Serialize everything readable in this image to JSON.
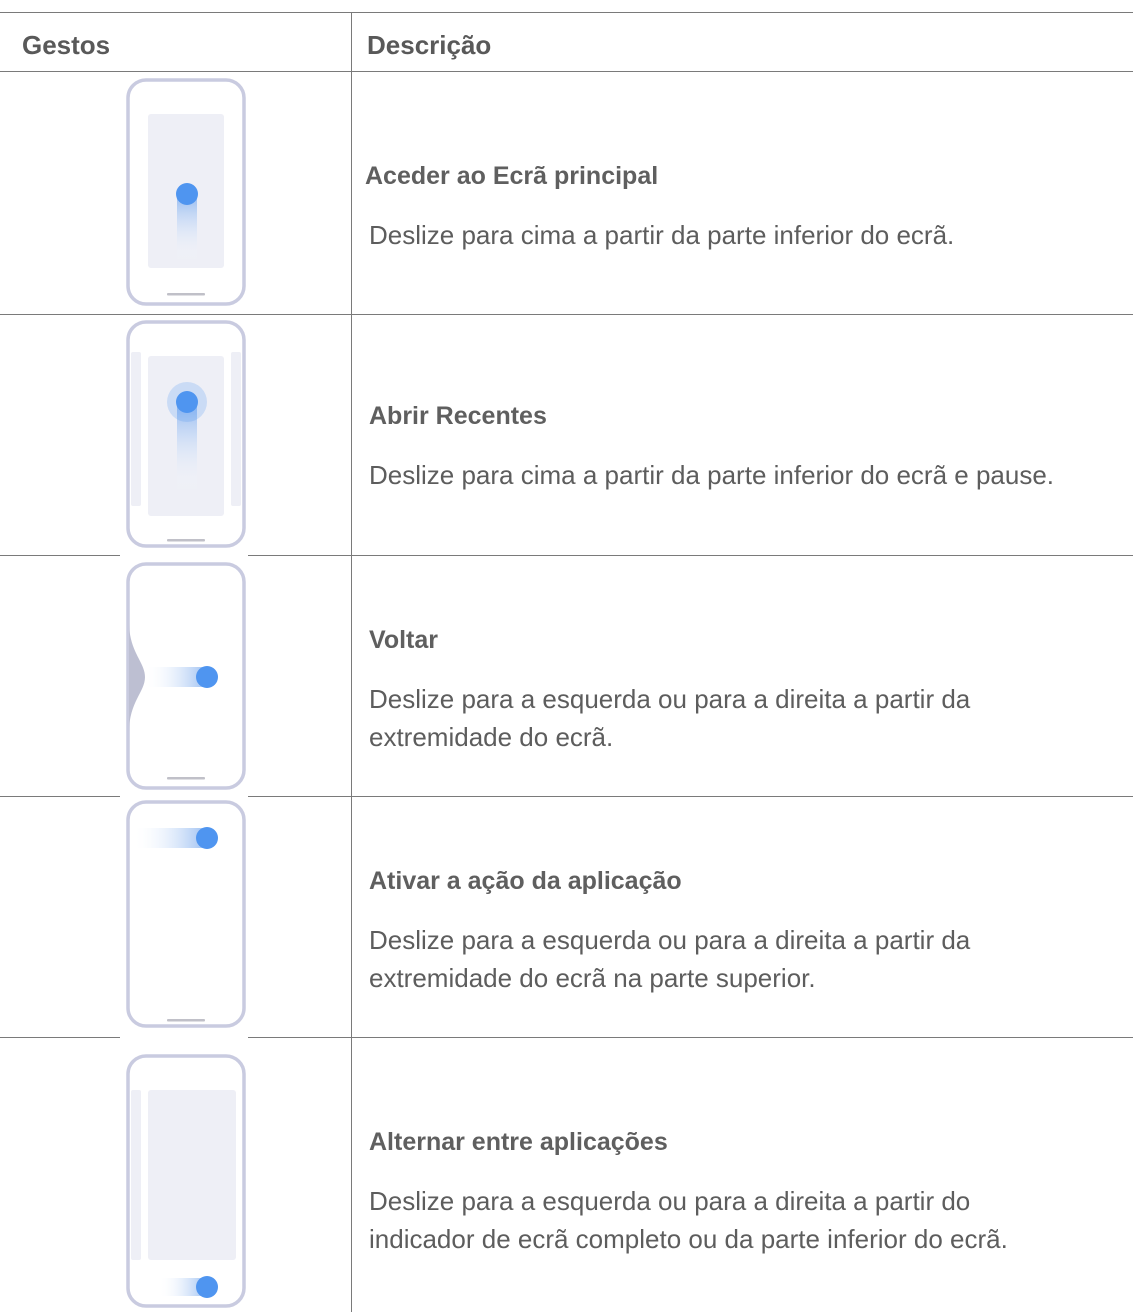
{
  "header": {
    "col_gestures": "Gestos",
    "col_description": "Descrição"
  },
  "rows": [
    {
      "icon": "swipe-up-home-icon",
      "title": "Aceder ao Ecrã principal",
      "description": [
        "Deslize para cima a partir da parte inferior do ecrã."
      ]
    },
    {
      "icon": "swipe-up-pause-recents-icon",
      "title": "Abrir Recentes",
      "description": [
        "Deslize para cima a partir da parte inferior do ecrã e pause."
      ]
    },
    {
      "icon": "swipe-edge-back-icon",
      "title": "Voltar",
      "description": [
        "Deslize para a esquerda ou para a direita a partir da",
        "extremidade do ecrã."
      ]
    },
    {
      "icon": "swipe-top-edge-action-icon",
      "title": "Ativar a ação da aplicação",
      "description": [
        "Deslize para a esquerda ou para a direita a partir da",
        "extremidade do ecrã na parte superior."
      ]
    },
    {
      "icon": "swipe-bottom-switch-apps-icon",
      "title": "Alternar entre aplicações",
      "description": [
        "Deslize para a esquerda ou para a direita a partir do",
        "indicador de ecrã completo ou da parte inferior do ecrã."
      ]
    }
  ],
  "colors": {
    "border": "#7a7a7a",
    "phone_outline": "#c9cbe0",
    "screen_fill": "#eeeff6",
    "accent_dot": "#4f95f0",
    "text": "#5d5d5d"
  }
}
